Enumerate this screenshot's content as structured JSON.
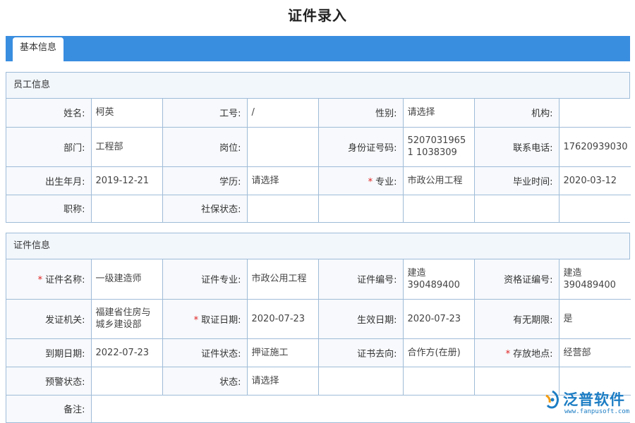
{
  "title": "证件录入",
  "tabs": [
    {
      "label": "基本信息"
    }
  ],
  "employee": {
    "header": "员工信息",
    "rows": [
      [
        {
          "label": "姓名:",
          "value": "柯英",
          "required": false
        },
        {
          "label": "工号:",
          "value": "/",
          "required": false
        },
        {
          "label": "性别:",
          "value": "请选择",
          "required": false
        },
        {
          "label": "机构:",
          "value": "",
          "required": false
        }
      ],
      [
        {
          "label": "部门:",
          "value": "工程部",
          "required": false
        },
        {
          "label": "岗位:",
          "value": "",
          "required": false
        },
        {
          "label": "身份证号码:",
          "value": "52070319651 1038309",
          "required": false
        },
        {
          "label": "联系电话:",
          "value": "17620939030",
          "required": false
        }
      ],
      [
        {
          "label": "出生年月:",
          "value": "2019-12-21",
          "required": false
        },
        {
          "label": "学历:",
          "value": "请选择",
          "required": false
        },
        {
          "label": "专业:",
          "value": "市政公用工程",
          "required": true
        },
        {
          "label": "毕业时间:",
          "value": "2020-03-12",
          "required": false
        }
      ],
      [
        {
          "label": "职称:",
          "value": "",
          "required": false
        },
        {
          "label": "社保状态:",
          "value": "",
          "required": false
        },
        {
          "label": "",
          "value": "",
          "required": false
        },
        {
          "label": "",
          "value": "",
          "required": false
        }
      ]
    ]
  },
  "certificate": {
    "header": "证件信息",
    "rows": [
      [
        {
          "label": "证件名称:",
          "value": "一级建造师",
          "required": true
        },
        {
          "label": "证件专业:",
          "value": "市政公用工程",
          "required": false
        },
        {
          "label": "证件编号:",
          "value": "建造 390489400",
          "required": false
        },
        {
          "label": "资格证编号:",
          "value": "建造 390489400",
          "required": false
        }
      ],
      [
        {
          "label": "发证机关:",
          "value": "福建省住房与城乡建设部",
          "required": false
        },
        {
          "label": "取证日期:",
          "value": "2020-07-23",
          "required": true
        },
        {
          "label": "生效日期:",
          "value": "2020-07-23",
          "required": false
        },
        {
          "label": "有无期限:",
          "value": "是",
          "required": false
        }
      ],
      [
        {
          "label": "到期日期:",
          "value": "2022-07-23",
          "required": false
        },
        {
          "label": "证件状态:",
          "value": "押证施工",
          "required": false
        },
        {
          "label": "证书去向:",
          "value": "合作方(在册)",
          "required": false
        },
        {
          "label": "存放地点:",
          "value": "经营部",
          "required": true
        }
      ],
      [
        {
          "label": "预警状态:",
          "value": "",
          "required": false
        },
        {
          "label": "状态:",
          "value": "请选择",
          "required": false
        },
        {
          "label": "",
          "value": "",
          "required": false
        },
        {
          "label": "",
          "value": "",
          "required": false
        }
      ]
    ],
    "remark_label": "备注:",
    "remark_value": ""
  },
  "watermark": {
    "name": "泛普软件",
    "url": "www.fanpusoft.com"
  },
  "colors": {
    "tabbar": "#3a8ee0",
    "border": "#9fbcd8",
    "header_bg": "#f2f7fc",
    "required": "#e02020",
    "logo": "#1c7dc4"
  }
}
